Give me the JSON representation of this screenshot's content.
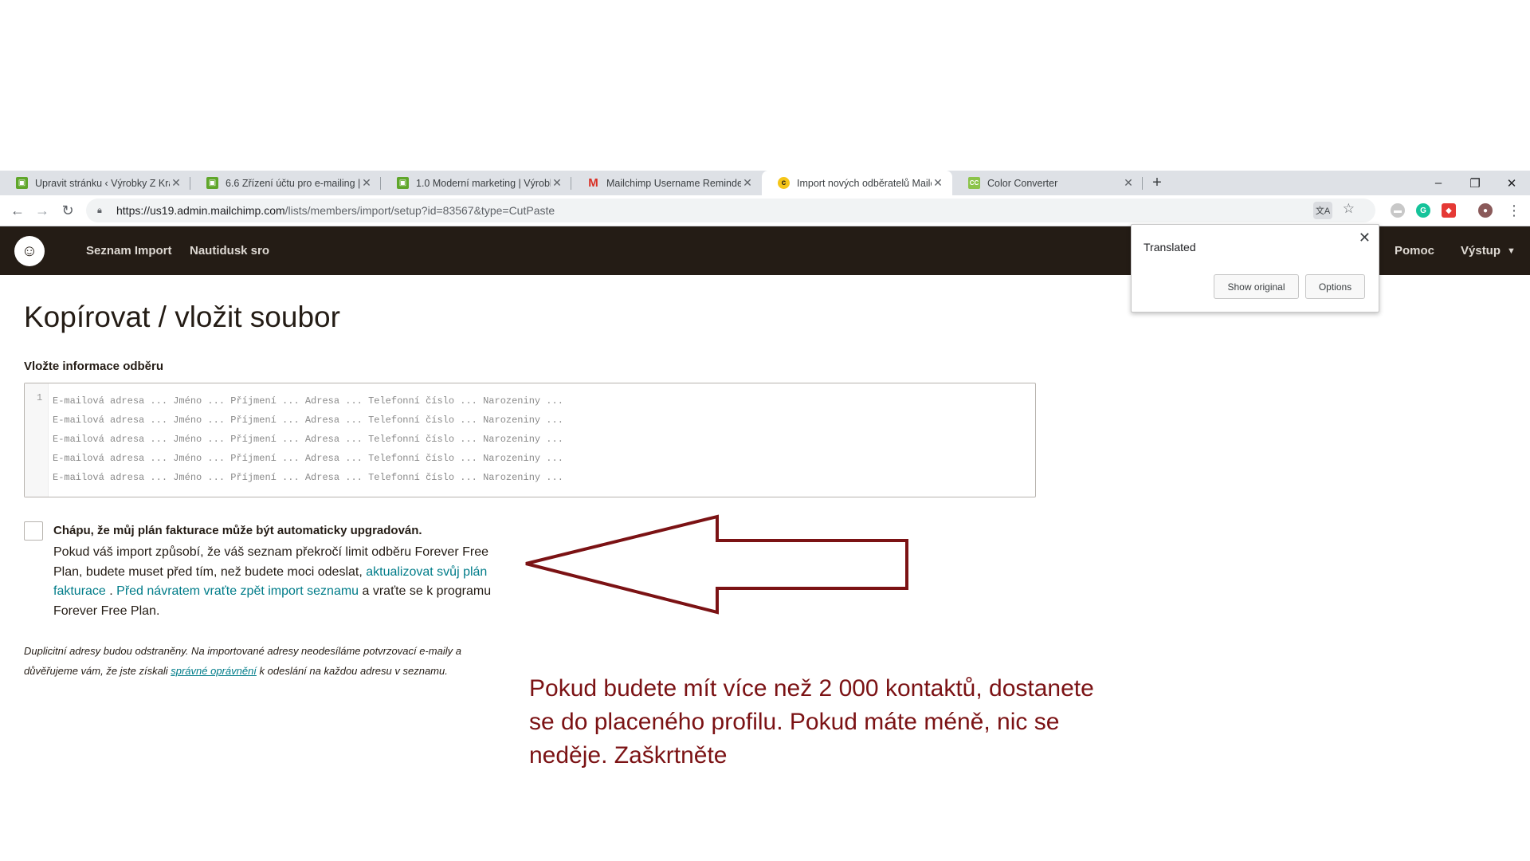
{
  "browser": {
    "tabs": [
      {
        "title": "Upravit stránku ‹ Výrobky Z Kraje",
        "favicon": "woo-icon"
      },
      {
        "title": "6.6 Zřízení účtu pro e-mailing | Vý",
        "favicon": "woo-icon"
      },
      {
        "title": "1.0 Moderní marketing | Výrobky",
        "favicon": "woo-icon"
      },
      {
        "title": "Mailchimp Username Reminder -",
        "favicon": "gmail-icon"
      },
      {
        "title": "Import nových odběratelů Mailch",
        "favicon": "mailchimp-icon",
        "active": true
      },
      {
        "title": "Color Converter",
        "favicon": "color-converter-icon"
      }
    ],
    "new_tab": "+",
    "window_controls": {
      "minimize": "–",
      "restore": "❐",
      "close": "✕"
    },
    "url_host": "https://us19.admin.mailchimp.com",
    "url_path": "/lists/members/import/setup?id=83567&type=CutPaste"
  },
  "header": {
    "nav_left": [
      "Seznam Import",
      "Nautidusk sro"
    ],
    "help": "Pomoc",
    "logout": "Výstup"
  },
  "translate_popup": {
    "title": "Translated",
    "show_original": "Show original",
    "options": "Options"
  },
  "page": {
    "title": "Kopírovat / vložit soubor",
    "field_label": "Vložte informace odběru",
    "editor_line_number": "1",
    "editor_placeholder_lines": [
      "E-mailová adresa ... Jméno ... Příjmení ... Adresa ... Telefonní číslo ... Narozeniny ...",
      "E-mailová adresa ... Jméno ... Příjmení ... Adresa ... Telefonní číslo ... Narozeniny ...",
      "E-mailová adresa ... Jméno ... Příjmení ... Adresa ... Telefonní číslo ... Narozeniny ...",
      "E-mailová adresa ... Jméno ... Příjmení ... Adresa ... Telefonní číslo ... Narozeniny ...",
      "E-mailová adresa ... Jméno ... Příjmení ... Adresa ... Telefonní číslo ... Narozeniny ..."
    ],
    "checkbox_title": "Chápu, že můj plán fakturace může být automaticky upgradován.",
    "checkbox_text_1": "Pokud váš import způsobí, že váš seznam překročí limit odběru Forever Free Plan, budete muset před tím, než budete moci odeslat, ",
    "checkbox_link_1": "aktualizovat svůj plán fakturace",
    "checkbox_text_2": " . ",
    "checkbox_link_2": "Před návratem vraťte zpět import seznamu",
    "checkbox_text_3": " a vraťte se k programu Forever Free Plan.",
    "note_text_1": "Duplicitní adresy budou odstraněny. Na importované adresy neodesíláme potvrzovací e-maily a důvěřujeme vám, že jste získali ",
    "note_link": "správné oprávnění",
    "note_text_2": " k odeslání na každou adresu v seznamu."
  },
  "annotation": {
    "text": "Pokud budete mít více než 2 000 kontaktů, dostanete se do placeného profilu. Pokud máte méně, nic se neděje. Zaškrtněte",
    "color": "#7b1214"
  }
}
